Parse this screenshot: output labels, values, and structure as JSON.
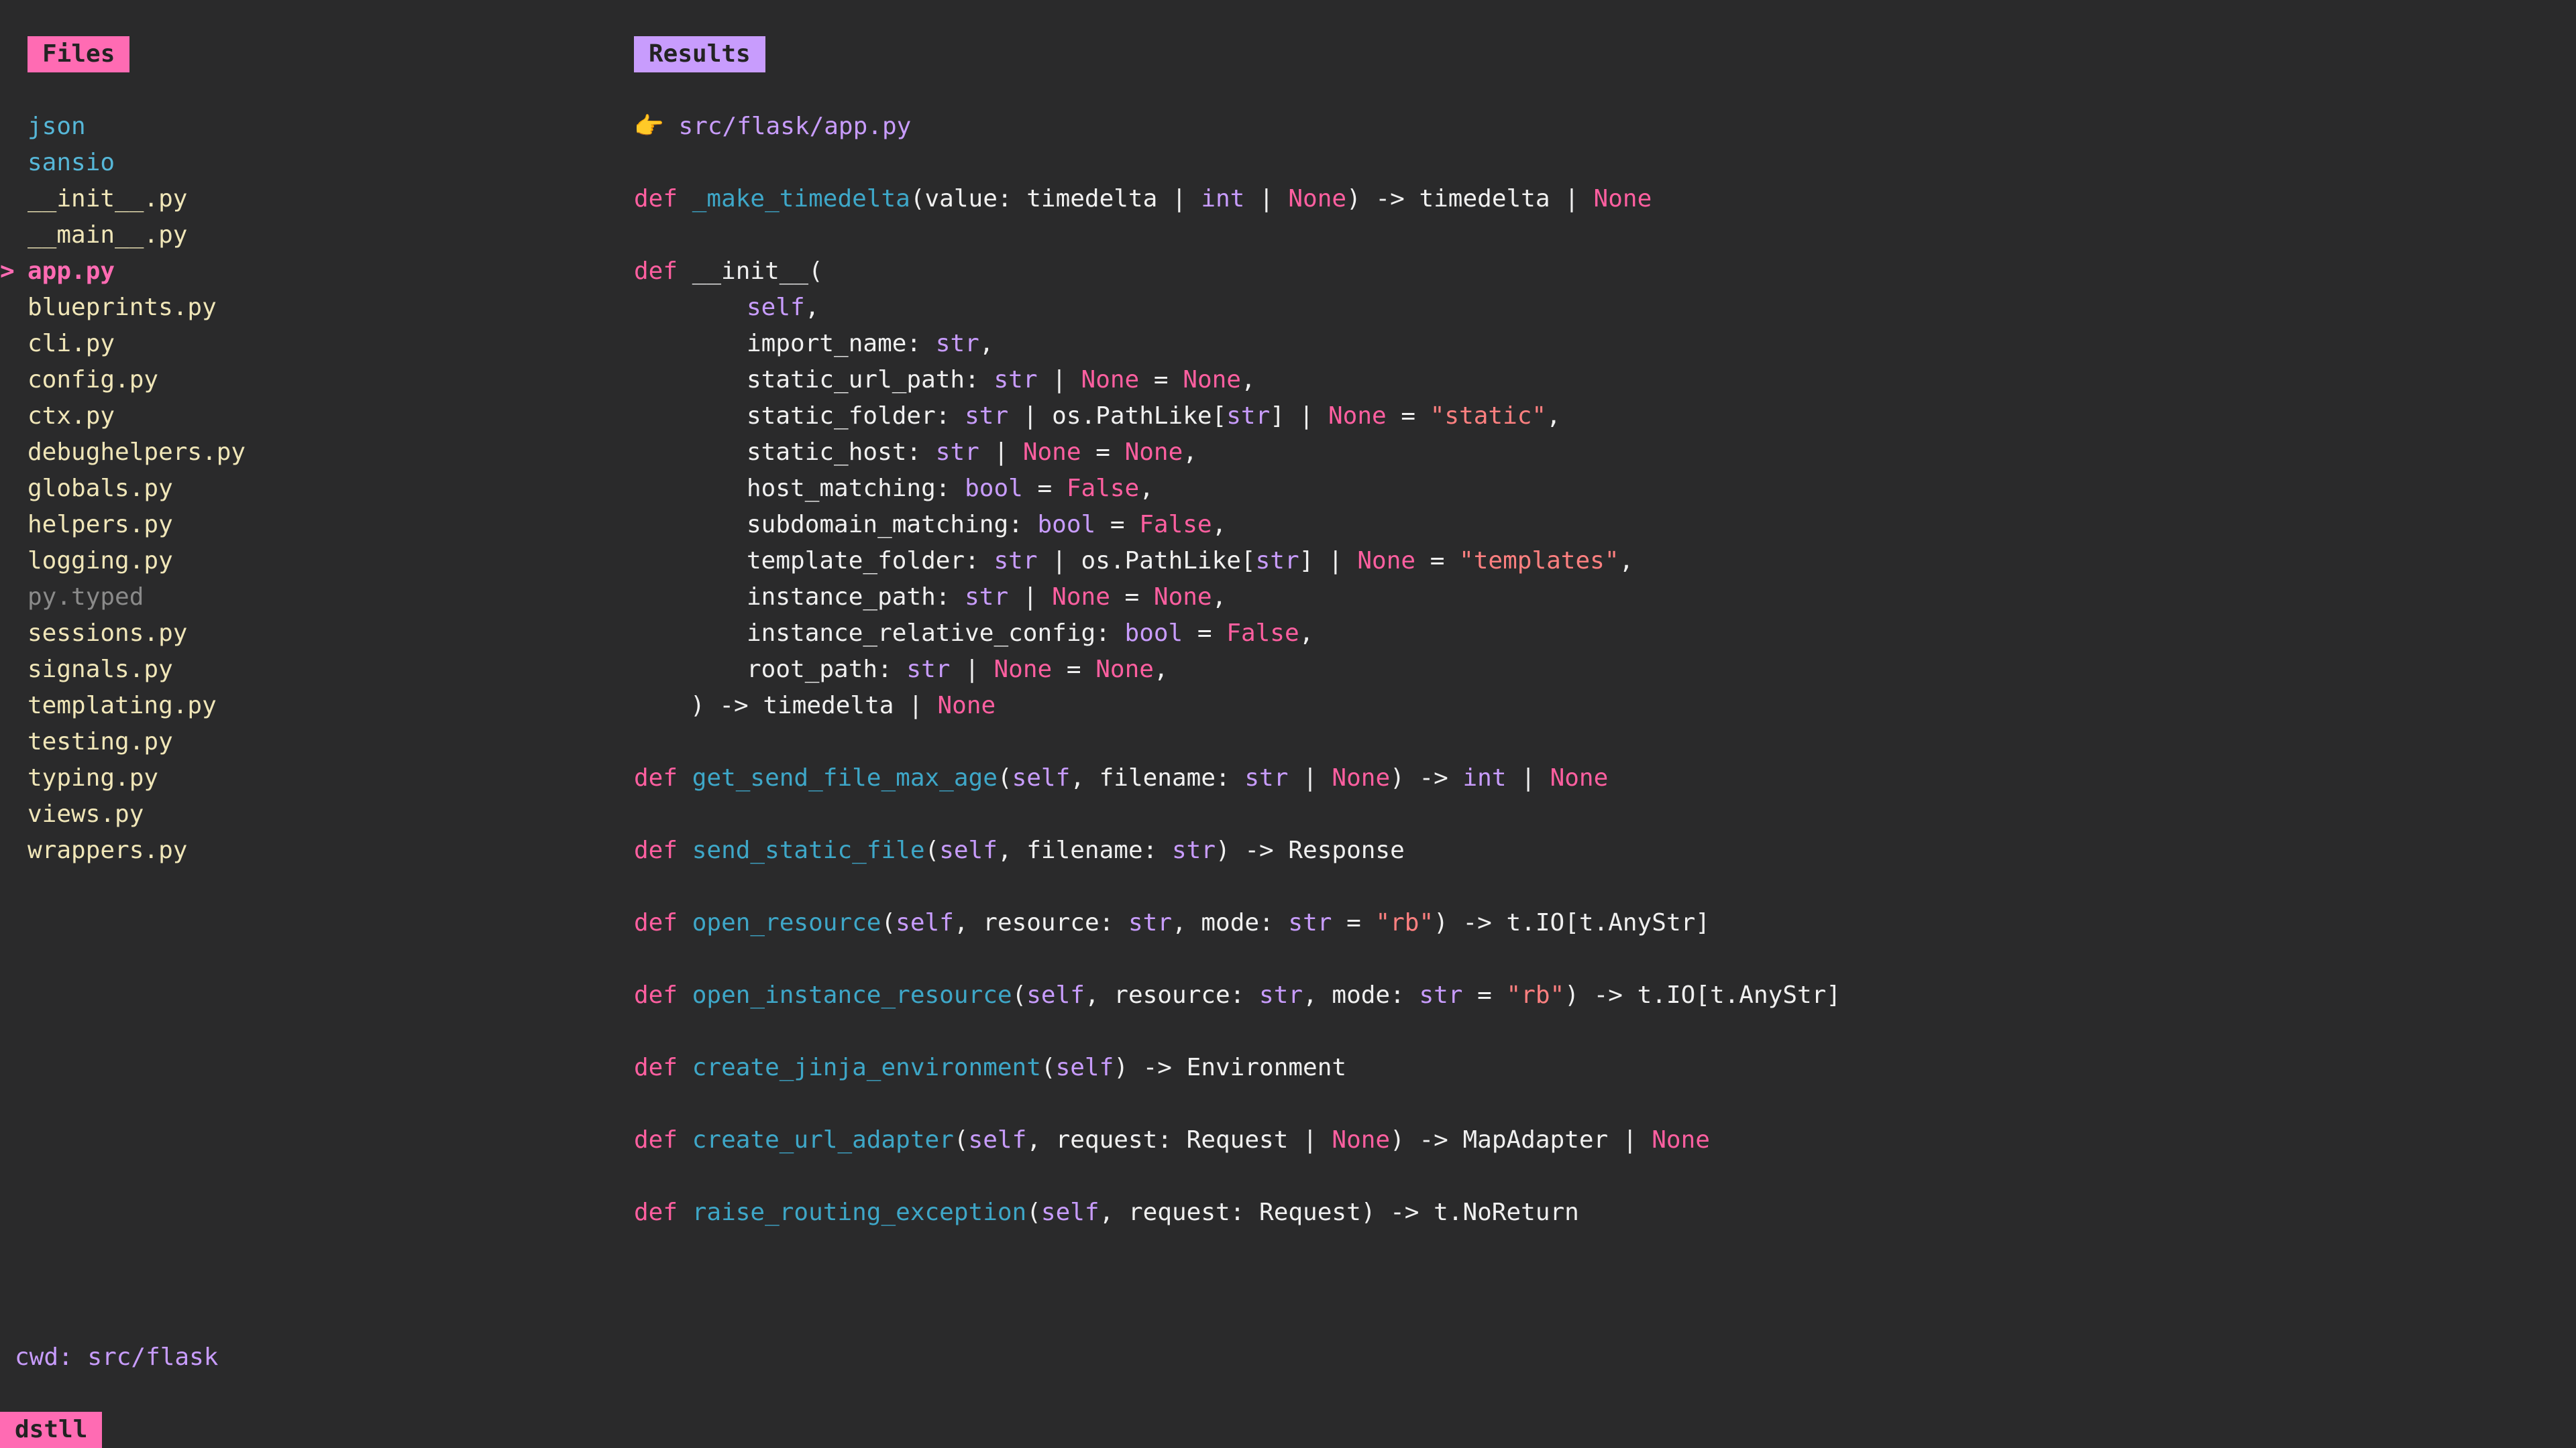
{
  "files_pane": {
    "title": "Files",
    "selected_marker": ">",
    "items": [
      {
        "label": "json",
        "kind": "dir"
      },
      {
        "label": "sansio",
        "kind": "dir"
      },
      {
        "label": "__init__.py",
        "kind": "file"
      },
      {
        "label": "__main__.py",
        "kind": "file"
      },
      {
        "label": "app.py",
        "kind": "selected"
      },
      {
        "label": "blueprints.py",
        "kind": "file"
      },
      {
        "label": "cli.py",
        "kind": "file"
      },
      {
        "label": "config.py",
        "kind": "file"
      },
      {
        "label": "ctx.py",
        "kind": "file"
      },
      {
        "label": "debughelpers.py",
        "kind": "file"
      },
      {
        "label": "globals.py",
        "kind": "file"
      },
      {
        "label": "helpers.py",
        "kind": "file"
      },
      {
        "label": "logging.py",
        "kind": "file"
      },
      {
        "label": "py.typed",
        "kind": "muted"
      },
      {
        "label": "sessions.py",
        "kind": "file"
      },
      {
        "label": "signals.py",
        "kind": "file"
      },
      {
        "label": "templating.py",
        "kind": "file"
      },
      {
        "label": "testing.py",
        "kind": "file"
      },
      {
        "label": "typing.py",
        "kind": "file"
      },
      {
        "label": "views.py",
        "kind": "file"
      },
      {
        "label": "wrappers.py",
        "kind": "file"
      }
    ]
  },
  "results_pane": {
    "title": "Results",
    "pointer_icon": "👉",
    "file_path": "src/flask/app.py",
    "lines": [
      {
        "indent": 0,
        "tokens": [
          [
            "kw",
            "def"
          ],
          [
            "pl",
            " "
          ],
          [
            "fn",
            "_make_timedelta"
          ],
          [
            "pl",
            "(value: timedelta | "
          ],
          [
            "bi",
            "int"
          ],
          [
            "pl",
            " | "
          ],
          [
            "nn",
            "None"
          ],
          [
            "pl",
            ") -> timedelta | "
          ],
          [
            "nn",
            "None"
          ]
        ]
      },
      {
        "blank": true
      },
      {
        "indent": 0,
        "tokens": [
          [
            "kw",
            "def"
          ],
          [
            "pl",
            " __init__("
          ]
        ]
      },
      {
        "indent": 4,
        "tokens": [
          [
            "bi",
            "self"
          ],
          [
            "pl",
            ","
          ]
        ]
      },
      {
        "indent": 4,
        "tokens": [
          [
            "pl",
            "import_name: "
          ],
          [
            "bi",
            "str"
          ],
          [
            "pl",
            ","
          ]
        ]
      },
      {
        "indent": 4,
        "tokens": [
          [
            "pl",
            "static_url_path: "
          ],
          [
            "bi",
            "str"
          ],
          [
            "pl",
            " | "
          ],
          [
            "nn",
            "None"
          ],
          [
            "pl",
            " = "
          ],
          [
            "nn",
            "None"
          ],
          [
            "pl",
            ","
          ]
        ]
      },
      {
        "indent": 4,
        "tokens": [
          [
            "pl",
            "static_folder: "
          ],
          [
            "bi",
            "str"
          ],
          [
            "pl",
            " | os.PathLike["
          ],
          [
            "bi",
            "str"
          ],
          [
            "pl",
            "] | "
          ],
          [
            "nn",
            "None"
          ],
          [
            "pl",
            " = "
          ],
          [
            "str",
            "\"static\""
          ],
          [
            "pl",
            ","
          ]
        ]
      },
      {
        "indent": 4,
        "tokens": [
          [
            "pl",
            "static_host: "
          ],
          [
            "bi",
            "str"
          ],
          [
            "pl",
            " | "
          ],
          [
            "nn",
            "None"
          ],
          [
            "pl",
            " = "
          ],
          [
            "nn",
            "None"
          ],
          [
            "pl",
            ","
          ]
        ]
      },
      {
        "indent": 4,
        "tokens": [
          [
            "pl",
            "host_matching: "
          ],
          [
            "bi",
            "bool"
          ],
          [
            "pl",
            " = "
          ],
          [
            "nn",
            "False"
          ],
          [
            "pl",
            ","
          ]
        ]
      },
      {
        "indent": 4,
        "tokens": [
          [
            "pl",
            "subdomain_matching: "
          ],
          [
            "bi",
            "bool"
          ],
          [
            "pl",
            " = "
          ],
          [
            "nn",
            "False"
          ],
          [
            "pl",
            ","
          ]
        ]
      },
      {
        "indent": 4,
        "tokens": [
          [
            "pl",
            "template_folder: "
          ],
          [
            "bi",
            "str"
          ],
          [
            "pl",
            " | os.PathLike["
          ],
          [
            "bi",
            "str"
          ],
          [
            "pl",
            "] | "
          ],
          [
            "nn",
            "None"
          ],
          [
            "pl",
            " = "
          ],
          [
            "str",
            "\"templates\""
          ],
          [
            "pl",
            ","
          ]
        ]
      },
      {
        "indent": 4,
        "tokens": [
          [
            "pl",
            "instance_path: "
          ],
          [
            "bi",
            "str"
          ],
          [
            "pl",
            " | "
          ],
          [
            "nn",
            "None"
          ],
          [
            "pl",
            " = "
          ],
          [
            "nn",
            "None"
          ],
          [
            "pl",
            ","
          ]
        ]
      },
      {
        "indent": 4,
        "tokens": [
          [
            "pl",
            "instance_relative_config: "
          ],
          [
            "bi",
            "bool"
          ],
          [
            "pl",
            " = "
          ],
          [
            "nn",
            "False"
          ],
          [
            "pl",
            ","
          ]
        ]
      },
      {
        "indent": 4,
        "tokens": [
          [
            "pl",
            "root_path: "
          ],
          [
            "bi",
            "str"
          ],
          [
            "pl",
            " | "
          ],
          [
            "nn",
            "None"
          ],
          [
            "pl",
            " = "
          ],
          [
            "nn",
            "None"
          ],
          [
            "pl",
            ","
          ]
        ]
      },
      {
        "indent": 2,
        "tokens": [
          [
            "pl",
            ") -> timedelta | "
          ],
          [
            "nn",
            "None"
          ]
        ]
      },
      {
        "blank": true
      },
      {
        "indent": 0,
        "tokens": [
          [
            "kw",
            "def"
          ],
          [
            "pl",
            " "
          ],
          [
            "fn",
            "get_send_file_max_age"
          ],
          [
            "pl",
            "("
          ],
          [
            "bi",
            "self"
          ],
          [
            "pl",
            ", filename: "
          ],
          [
            "bi",
            "str"
          ],
          [
            "pl",
            " | "
          ],
          [
            "nn",
            "None"
          ],
          [
            "pl",
            ") -> "
          ],
          [
            "bi",
            "int"
          ],
          [
            "pl",
            " | "
          ],
          [
            "nn",
            "None"
          ]
        ]
      },
      {
        "blank": true
      },
      {
        "indent": 0,
        "tokens": [
          [
            "kw",
            "def"
          ],
          [
            "pl",
            " "
          ],
          [
            "fn",
            "send_static_file"
          ],
          [
            "pl",
            "("
          ],
          [
            "bi",
            "self"
          ],
          [
            "pl",
            ", filename: "
          ],
          [
            "bi",
            "str"
          ],
          [
            "pl",
            ") -> Response"
          ]
        ]
      },
      {
        "blank": true
      },
      {
        "indent": 0,
        "tokens": [
          [
            "kw",
            "def"
          ],
          [
            "pl",
            " "
          ],
          [
            "fn",
            "open_resource"
          ],
          [
            "pl",
            "("
          ],
          [
            "bi",
            "self"
          ],
          [
            "pl",
            ", resource: "
          ],
          [
            "bi",
            "str"
          ],
          [
            "pl",
            ", mode: "
          ],
          [
            "bi",
            "str"
          ],
          [
            "pl",
            " = "
          ],
          [
            "str",
            "\"rb\""
          ],
          [
            "pl",
            ") -> t.IO[t.AnyStr]"
          ]
        ]
      },
      {
        "blank": true
      },
      {
        "indent": 0,
        "tokens": [
          [
            "kw",
            "def"
          ],
          [
            "pl",
            " "
          ],
          [
            "fn",
            "open_instance_resource"
          ],
          [
            "pl",
            "("
          ],
          [
            "bi",
            "self"
          ],
          [
            "pl",
            ", resource: "
          ],
          [
            "bi",
            "str"
          ],
          [
            "pl",
            ", mode: "
          ],
          [
            "bi",
            "str"
          ],
          [
            "pl",
            " = "
          ],
          [
            "str",
            "\"rb\""
          ],
          [
            "pl",
            ") -> t.IO[t.AnyStr]"
          ]
        ]
      },
      {
        "blank": true
      },
      {
        "indent": 0,
        "tokens": [
          [
            "kw",
            "def"
          ],
          [
            "pl",
            " "
          ],
          [
            "fn",
            "create_jinja_environment"
          ],
          [
            "pl",
            "("
          ],
          [
            "bi",
            "self"
          ],
          [
            "pl",
            ") -> Environment"
          ]
        ]
      },
      {
        "blank": true
      },
      {
        "indent": 0,
        "tokens": [
          [
            "kw",
            "def"
          ],
          [
            "pl",
            " "
          ],
          [
            "fn",
            "create_url_adapter"
          ],
          [
            "pl",
            "("
          ],
          [
            "bi",
            "self"
          ],
          [
            "pl",
            ", request: Request | "
          ],
          [
            "nn",
            "None"
          ],
          [
            "pl",
            ") -> MapAdapter | "
          ],
          [
            "nn",
            "None"
          ]
        ]
      },
      {
        "blank": true
      },
      {
        "indent": 0,
        "tokens": [
          [
            "kw",
            "def"
          ],
          [
            "pl",
            " "
          ],
          [
            "fn",
            "raise_routing_exception"
          ],
          [
            "pl",
            "("
          ],
          [
            "bi",
            "self"
          ],
          [
            "pl",
            ", request: Request) -> t.NoReturn"
          ]
        ]
      }
    ]
  },
  "status": {
    "cwd_label": "cwd:",
    "cwd_value": "src/flask",
    "app_name": "dstll"
  },
  "colors": {
    "background": "#2a2a2b",
    "accent_pink": "#ff6bb3",
    "accent_purple": "#c89cfd",
    "keyword": "#ff5fa0",
    "function": "#3ea7c8",
    "string": "#ff8080",
    "directory": "#56b7d8",
    "file": "#f0e6b8"
  }
}
